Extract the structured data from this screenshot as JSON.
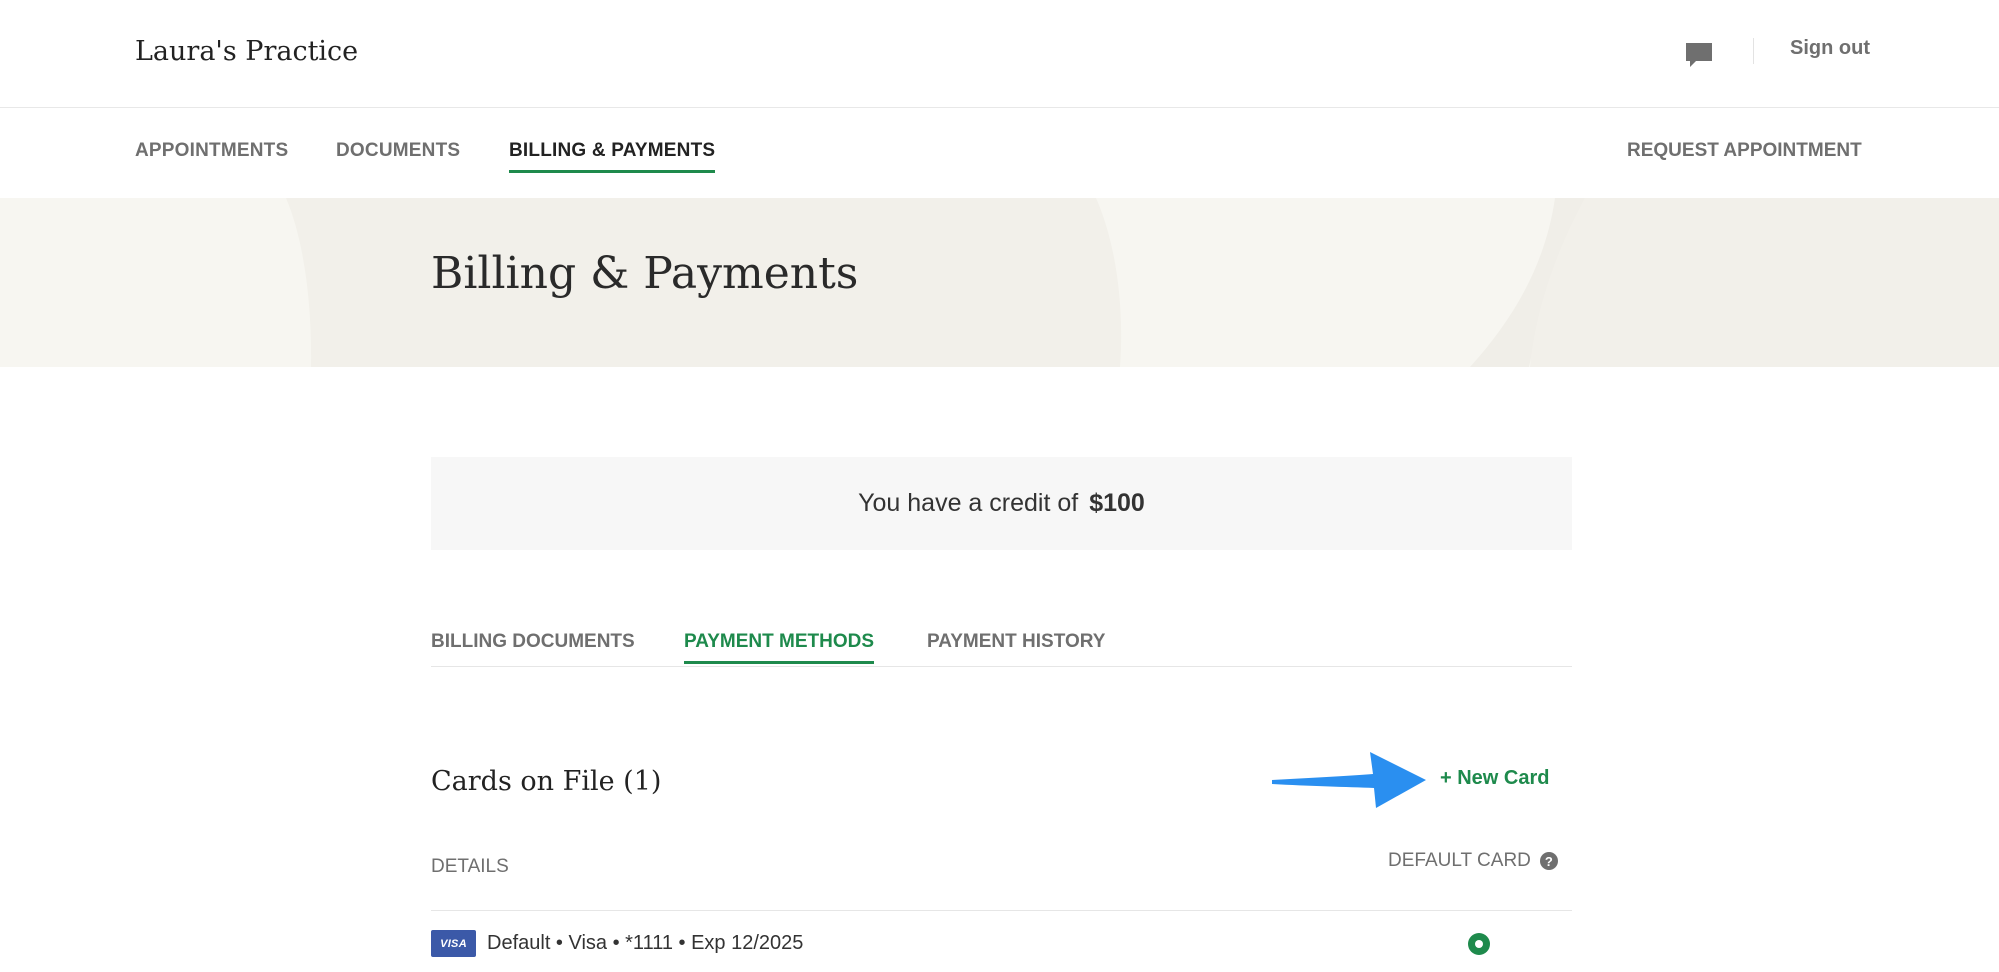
{
  "header": {
    "practice_name": "Laura's Practice",
    "messages_icon": "chat-bubble-icon",
    "sign_out_label": "Sign out"
  },
  "main_nav": {
    "tabs": [
      {
        "label": "APPOINTMENTS",
        "active": false
      },
      {
        "label": "DOCUMENTS",
        "active": false
      },
      {
        "label": "BILLING & PAYMENTS",
        "active": true
      }
    ],
    "request_appointment_label": "REQUEST APPOINTMENT"
  },
  "hero": {
    "title": "Billing & Payments"
  },
  "credit": {
    "text": "You have a credit of",
    "amount": "$100"
  },
  "sub_tabs": [
    {
      "label": "BILLING DOCUMENTS",
      "active": false
    },
    {
      "label": "PAYMENT METHODS",
      "active": true
    },
    {
      "label": "PAYMENT HISTORY",
      "active": false
    }
  ],
  "cards_section": {
    "title": "Cards on File (1)",
    "new_card_label": "+ New Card",
    "details_header": "DETAILS",
    "default_card_header": "DEFAULT CARD",
    "help_glyph": "?",
    "cards": [
      {
        "brand_badge": "VISA",
        "description": "Default • Visa • *1111 • Exp 12/2025",
        "is_default": true
      }
    ]
  },
  "colors": {
    "accent_green": "#1e8a4c",
    "annotation_arrow": "#2a8ff0",
    "hero_background": "#f2f0ea",
    "visa_blue": "#3b59a8"
  }
}
